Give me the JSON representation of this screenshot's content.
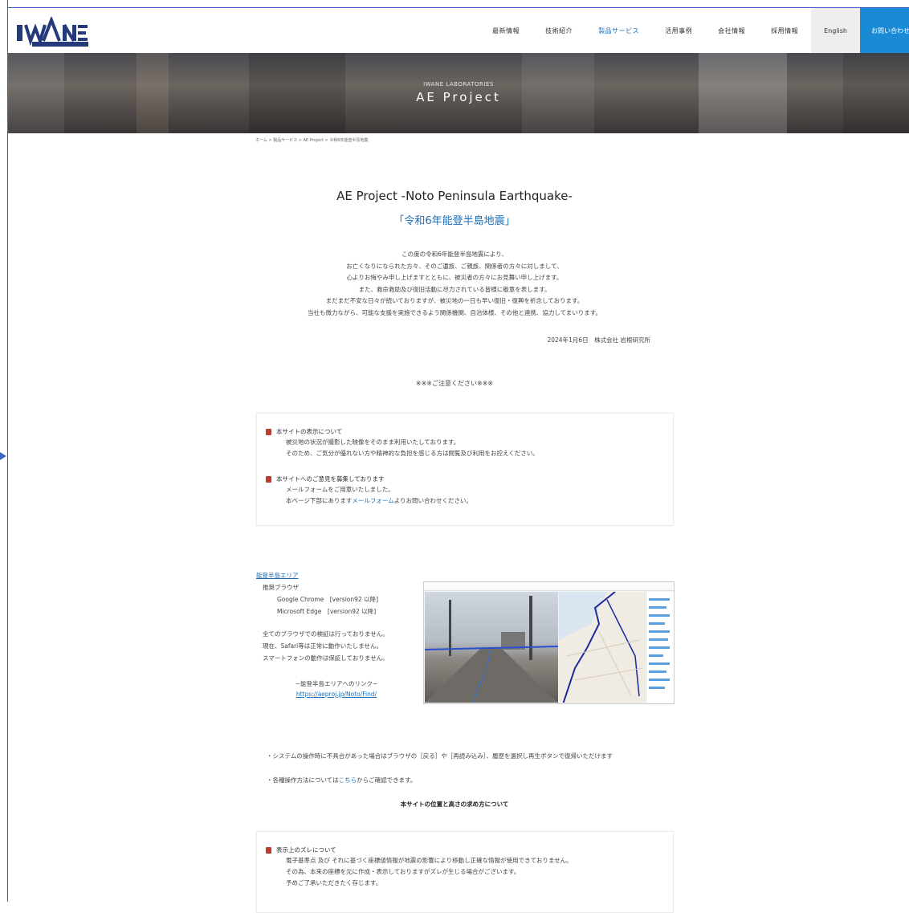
{
  "header": {
    "logo_text": "IWANE",
    "logo_sub": "LABORATORIES",
    "nav": [
      {
        "label": "最新情報",
        "active": false
      },
      {
        "label": "技術紹介",
        "active": false
      },
      {
        "label": "製品サービス",
        "active": true
      },
      {
        "label": "活用事例",
        "active": false
      },
      {
        "label": "会社情報",
        "active": false
      },
      {
        "label": "採用情報",
        "active": false
      }
    ],
    "english_label": "English",
    "contact_label": "お問い合わせ"
  },
  "hero": {
    "subtitle": "IWANE LABORATORIES",
    "title": "AE Project"
  },
  "breadcrumb": "ホーム > 製品サービス > AE Project > 令和6年能登半島地震",
  "main": {
    "title": "AE Project -Noto Peninsula Earthquake-",
    "subtitle": "「令和6年能登半島地震」",
    "message_lines": [
      "この度の令和6年能登半島地震により、",
      "お亡くなりになられた方々、そのご遺族、ご親族、関係者の方々に対しまして、",
      "心よりお悔やみ申し上げますとともに、被災者の方々にお見舞い申し上げます。",
      "また、救命救助及び復旧活動に尽力されている皆様に敬意を表します。",
      "まだまだ不安な日々が続いておりますが、被災地の一日も早い復旧・復興を祈念しております。",
      "当社も微力ながら、可能な支援を実施できるよう関係機関、自治体様、その他と連携、協力してまいります。"
    ],
    "signature": "2024年1月6日　株式会社 岩根研究所",
    "notice": "※※※ご注意ください※※※"
  },
  "notice_box": [
    {
      "heading": "本サイトの表示について",
      "lines": [
        "被災地の状況が撮影した映像をそのまま利用いたしております。",
        "そのため、ご気分が優れない方や精神的な負担を感じる方は閲覧及び利用をお控えください。"
      ]
    },
    {
      "heading": "本サイトへのご意見を募集しております",
      "lines": [
        "メールフォームをご用意いたしました。",
        "本ページ下部にありますメールフォームよりお問い合わせください。"
      ],
      "link_text": "メールフォーム"
    }
  ],
  "area": {
    "link_label": "能登半島エリア",
    "browser_label": "推奨ブラウザ",
    "browsers": [
      "Google Chrome　[version92 以降]",
      "Microsoft Edge　[version92 以降]"
    ],
    "compat_lines": [
      "全てのブラウザでの検証は行っておりません。",
      "現在、Safari等は正常に動作いたしません。",
      "スマートフォンの動作は保証しておりません。"
    ],
    "link_caption": "~能登半島エリアへのリンク~",
    "link_url": "https://aeproj.jp/Noto/Find/"
  },
  "instructions": {
    "op_note": "・システムの操作時に不具合があった場合はブラウザの［戻る］や［再読み込み］、履歴を選択し再生ボタンで復帰いただけます",
    "op_detail_prefix": "・各種操作方法については",
    "op_detail_link": "こちら",
    "op_detail_suffix": "からご確認できます。",
    "how_title": "本サイトの位置と高さの求め方について"
  },
  "bottom_box": {
    "heading": "表示上のズレについて",
    "lines": [
      "電子基準点 及び それに基づく座標値情報が地震の影響により移動し正確な情報が使用できておりません。",
      "その為、本来の座標を元に作成・表示しておりますがズレが生じる場合がございます。",
      "予めご了承いただきたく存じます。"
    ]
  },
  "colors": {
    "accent": "#1a6fb8",
    "contact_bg": "#1a8ad4",
    "bullet": "#c0392b"
  }
}
